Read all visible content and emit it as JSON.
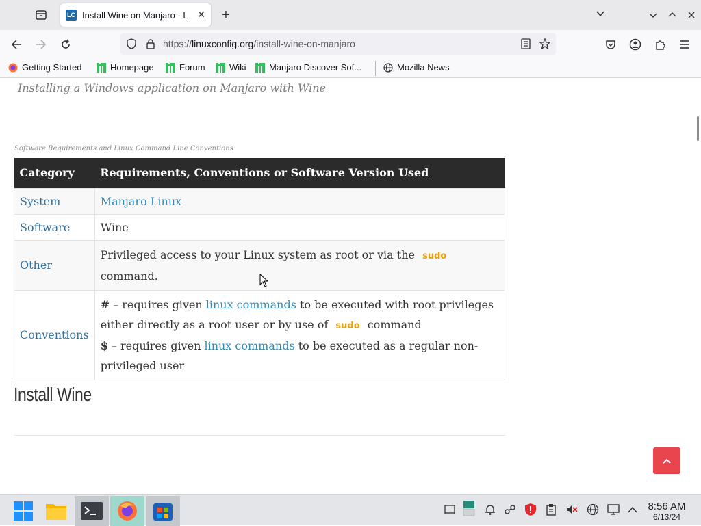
{
  "browser": {
    "tab": {
      "title": "Install Wine on Manjaro - L",
      "favicon_text": "LC"
    },
    "url": {
      "scheme": "https://",
      "host": "linuxconfig.org",
      "path": "/install-wine-on-manjaro"
    },
    "bookmarks": [
      {
        "label": "Getting Started",
        "icon": "firefox-icon"
      },
      {
        "label": "Homepage",
        "icon": "manjaro-icon"
      },
      {
        "label": "Forum",
        "icon": "manjaro-icon"
      },
      {
        "label": "Wiki",
        "icon": "manjaro-icon"
      },
      {
        "label": "Manjaro Discover Sof...",
        "icon": "manjaro-icon"
      },
      {
        "label": "Mozilla News",
        "icon": "globe-icon"
      }
    ]
  },
  "page": {
    "image_caption": "Installing a Windows application on Manjaro with Wine",
    "table_caption": "Software Requirements and Linux Command Line Conventions",
    "table": {
      "headers": [
        "Category",
        "Requirements, Conventions or Software Version Used"
      ],
      "rows": {
        "system": {
          "category": "System",
          "value": "Manjaro Linux"
        },
        "software": {
          "category": "Software",
          "value": "Wine"
        },
        "other": {
          "category": "Other",
          "text1": "Privileged access to your Linux system as root or via the",
          "sudo": "sudo",
          "text2": "command."
        },
        "conventions": {
          "category": "Conventions",
          "hash": "#",
          "line1_a": " – requires given ",
          "link": "linux commands",
          "line1_b": " to be executed with root privileges either directly as a root user or by use of",
          "sudo": "sudo",
          "line1_c": "command",
          "dollar": "$",
          "line2_a": " – requires given ",
          "line2_b": " to be executed as a regular non-privileged user"
        }
      }
    },
    "heading": "Install Wine",
    "colors": {
      "link": "#2f8ab8",
      "sudo": "#e8a010",
      "header_bg": "#2b2b2b",
      "back_to_top": "#e8454f"
    }
  },
  "taskbar": {
    "apps": [
      "start-menu-icon",
      "file-manager-icon",
      "terminal-icon",
      "firefox-icon",
      "software-store-icon"
    ],
    "clock": {
      "time": "8:56 AM",
      "date": "6/13/24"
    }
  }
}
